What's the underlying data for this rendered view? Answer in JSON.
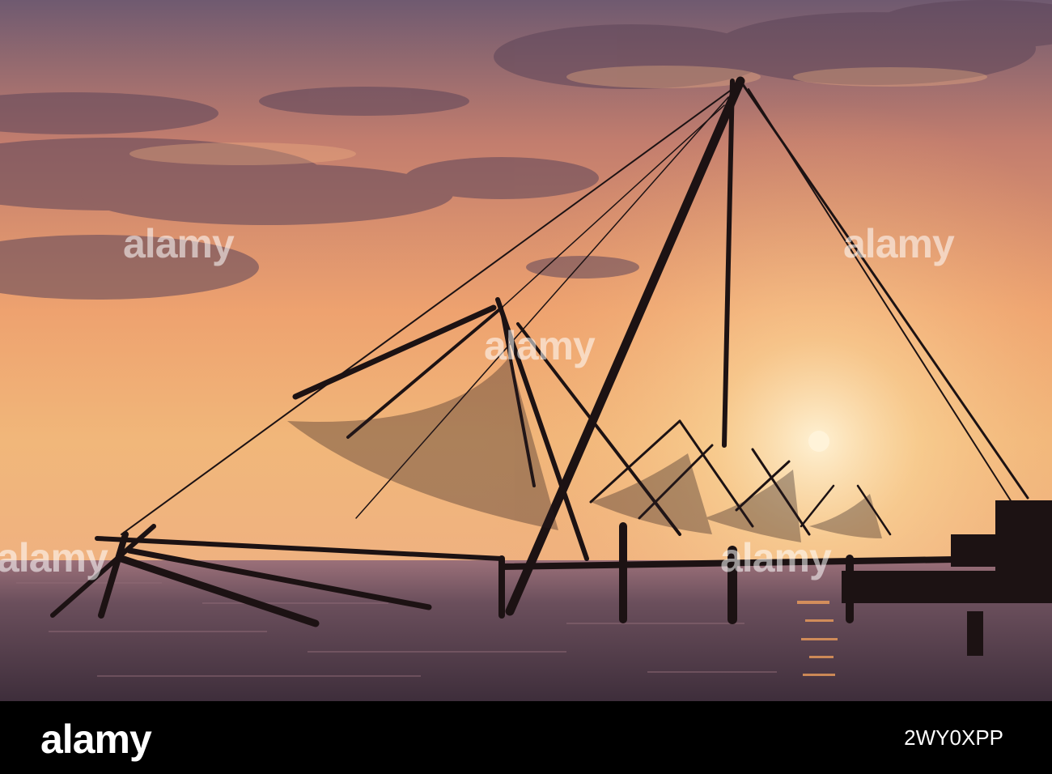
{
  "photo": {
    "subject": "Chinese fishing nets at sunset",
    "colors": {
      "sky_top": "#6b5a72",
      "sky_mid": "#e79d6a",
      "horizon": "#f4c27a",
      "sun": "#fff2d6",
      "silhouette": "#1e1314",
      "water": "#4f3d4a"
    }
  },
  "watermark": {
    "text": "alamy"
  },
  "footer": {
    "brand": "alamy",
    "image_id": "2WY0XPP"
  }
}
